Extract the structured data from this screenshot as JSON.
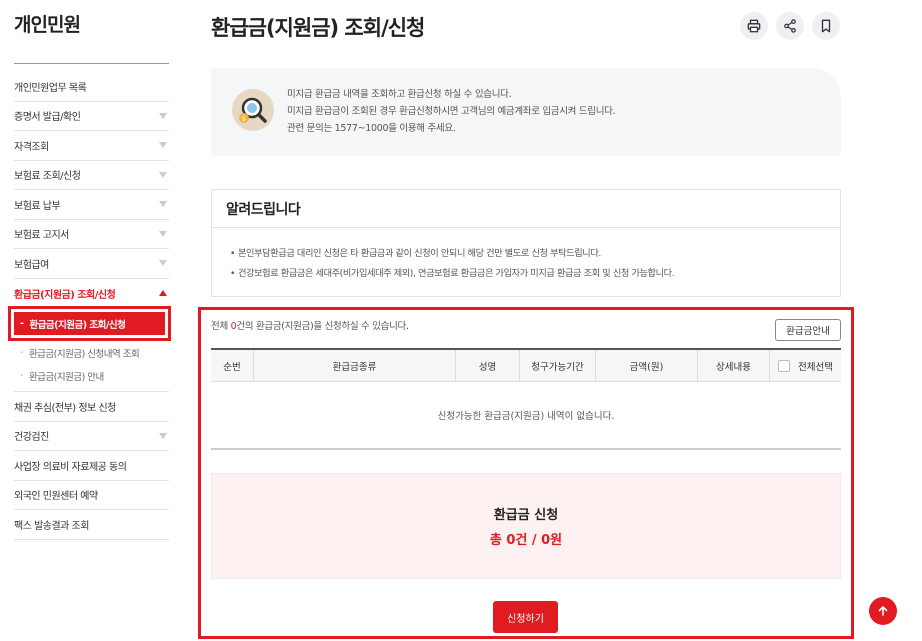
{
  "sidebar": {
    "title": "개인민원",
    "items": [
      {
        "label": "개인민원업무 목록",
        "arrow": false
      },
      {
        "label": "증명서 발급/확인",
        "arrow": true
      },
      {
        "label": "자격조회",
        "arrow": true
      },
      {
        "label": "보험료 조회/신청",
        "arrow": true
      },
      {
        "label": "보험료 납부",
        "arrow": true
      },
      {
        "label": "보험료 고지서",
        "arrow": true
      },
      {
        "label": "보험급여",
        "arrow": true
      }
    ],
    "active": {
      "label": "환급금(지원금) 조회/신청",
      "subitems": [
        {
          "label": "환급금(지원금) 조회/신청",
          "current": true
        },
        {
          "label": "환급금(지원금) 신청내역 조회",
          "current": false
        },
        {
          "label": "환급금(지원금) 안내",
          "current": false
        }
      ]
    },
    "items_after": [
      {
        "label": "채권 추심(전부) 정보 신청",
        "arrow": false
      },
      {
        "label": "건강검진",
        "arrow": true
      },
      {
        "label": "사업장 의료비 자료제공 동의",
        "arrow": false
      },
      {
        "label": "외국인 민원센터 예약",
        "arrow": false
      },
      {
        "label": "팩스 발송결과 조회",
        "arrow": false
      }
    ]
  },
  "header": {
    "title": "환급금(지원금) 조회/신청"
  },
  "info": {
    "lines": [
      "미지급 환급금 내역을 조회하고 환급신청 하실 수 있습니다.",
      "미지급 환급금이 조회된 경우 환급신청하시면 고객님의 예금계좌로 입금시켜 드립니다.",
      "관련 문의는 1577~1000을 이용해 주세요."
    ]
  },
  "notice": {
    "title": "알려드립니다",
    "items": [
      "본인부담환급금 대리인 신청은 타 환급금과 같이 신청이 안되니 해당 건만 별도로 신청 부탁드립니다.",
      "건강보험료 환급금은 세대주(비가입세대주 제외), 연금보험료 환급금은 가입자가 미지급 환급금 조회 및 신청 가능합니다."
    ]
  },
  "summary_line": {
    "prefix": "전체 ",
    "count": "0",
    "suffix": "건의 환급금(지원금)을 신청하실 수 있습니다."
  },
  "guide_button": "환급금안내",
  "table": {
    "headers": [
      "순번",
      "환급금종류",
      "성명",
      "청구가능기간",
      "금액(원)",
      "상세내용",
      "전체선택"
    ],
    "empty_message": "신청가능한 환급금(지원금) 내역이 없습니다."
  },
  "totals": {
    "title": "환급금 신청",
    "value": "총 0건 / 0원"
  },
  "apply_button": "신청하기",
  "colors": {
    "accent": "#e01b22"
  }
}
